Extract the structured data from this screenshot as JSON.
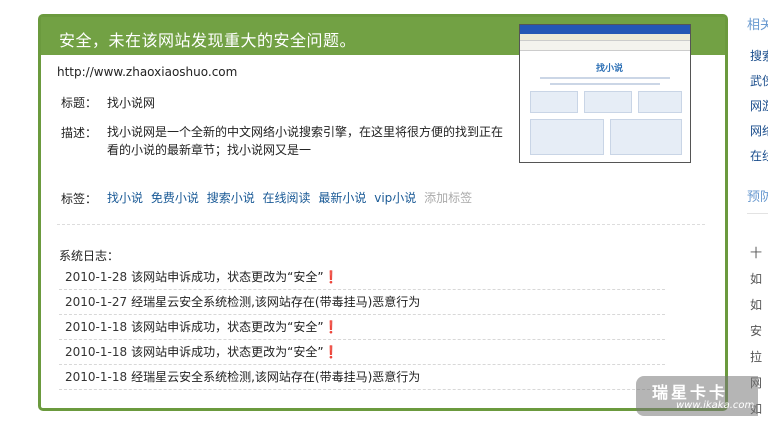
{
  "panel": {
    "title": "安全，未在该网站发现重大的安全问题。",
    "url": "http://www.zhaoxiaoshuo.com",
    "title_label": "标题：",
    "title_value": "找小说网",
    "desc_label": "描述：",
    "desc_value": "找小说网是一个全新的中文网络小说搜索引擎，在这里将很方便的找到正在看的小说的最新章节；找小说网又是一",
    "tags_label": "标签：",
    "tags": [
      "找小说",
      "免费小说",
      "搜索小说",
      "在线阅读",
      "最新小说",
      "vip小说"
    ],
    "add_tag": "添加标签",
    "log_title": "系统日志：",
    "logs": [
      {
        "date": "2010-1-28",
        "text": "该网站申诉成功，状态更改为“安全”❗"
      },
      {
        "date": "2010-1-27",
        "text": "经瑞星云安全系统检测,该网站存在(带毒挂马)恶意行为"
      },
      {
        "date": "2010-1-18",
        "text": "该网站申诉成功，状态更改为“安全”❗"
      },
      {
        "date": "2010-1-18",
        "text": "该网站申诉成功，状态更改为“安全”❗"
      },
      {
        "date": "2010-1-18",
        "text": "经瑞星云安全系统检测,该网站存在(带毒挂马)恶意行为"
      }
    ],
    "thumbnail_logo": "找小说"
  },
  "sidebar": {
    "heading1": "相关",
    "links": [
      "搜索",
      "武侠",
      "网游",
      "网络",
      "在线"
    ],
    "heading2": "预防",
    "bullets": [
      "十",
      "如",
      "如",
      "安",
      "拉",
      "网",
      "如"
    ]
  },
  "watermark": {
    "main": "瑞星卡卡",
    "sub": "www.ikaka.com"
  },
  "colors": {
    "header_green": "#72a144",
    "link_blue": "#1a5a96"
  }
}
